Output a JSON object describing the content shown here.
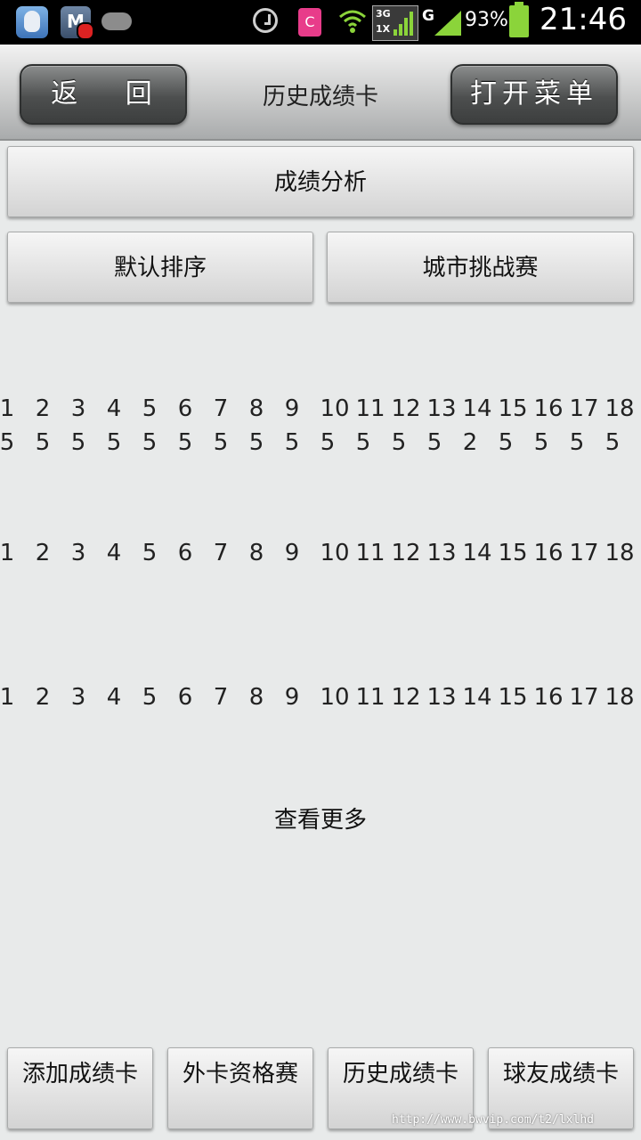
{
  "status_bar": {
    "icons": [
      "qq-icon",
      "mcafee-icon",
      "cloud-icon",
      "alarm-icon",
      "c-app-icon",
      "wifi-icon",
      "network-3g-1x-icon",
      "signal-icon",
      "battery-icon"
    ],
    "net_3g": "3G",
    "net_1x": "1X",
    "net_g": "G",
    "battery_pct": "93%",
    "time": "21:46",
    "c_label": "C"
  },
  "header": {
    "back_label": "返 回",
    "title": "历史成绩卡",
    "menu_label": "打开菜单"
  },
  "actions": {
    "analysis_label": "成绩分析",
    "sort_label": "默认排序",
    "city_label": "城市挑战赛"
  },
  "cards": [
    {
      "holes": [
        "1",
        "2",
        "3",
        "4",
        "5",
        "6",
        "7",
        "8",
        "9",
        "10",
        "11",
        "12",
        "13",
        "14",
        "15",
        "16",
        "17",
        "18"
      ],
      "scores": [
        "5",
        "5",
        "5",
        "5",
        "5",
        "5",
        "5",
        "5",
        "5",
        "5",
        "5",
        "5",
        "5",
        "2",
        "5",
        "5",
        "5",
        "5"
      ]
    },
    {
      "holes": [
        "1",
        "2",
        "3",
        "4",
        "5",
        "6",
        "7",
        "8",
        "9",
        "10",
        "11",
        "12",
        "13",
        "14",
        "15",
        "16",
        "17",
        "18"
      ],
      "scores": []
    },
    {
      "holes": [
        "1",
        "2",
        "3",
        "4",
        "5",
        "6",
        "7",
        "8",
        "9",
        "10",
        "11",
        "12",
        "13",
        "14",
        "15",
        "16",
        "17",
        "18"
      ],
      "scores": []
    }
  ],
  "more_label": "查看更多",
  "bottom_nav": [
    {
      "label": "添加成绩卡"
    },
    {
      "label": "外卡资格赛"
    },
    {
      "label": "历史成绩卡"
    },
    {
      "label": "球友成绩卡"
    }
  ],
  "watermark": "http://www.bwvip.com/t2/lxlhd"
}
